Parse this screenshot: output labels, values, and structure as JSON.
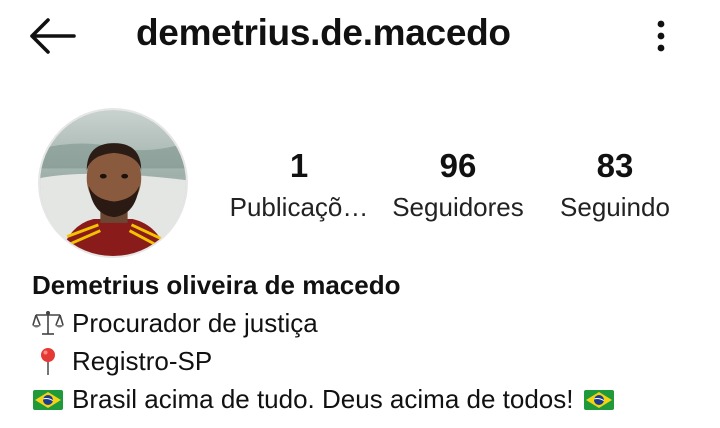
{
  "header": {
    "username": "demetrius.de.macedo"
  },
  "stats": {
    "posts": {
      "value": "1",
      "label": "Publicaçõ…"
    },
    "followers": {
      "value": "96",
      "label": "Seguidores"
    },
    "following": {
      "value": "83",
      "label": "Seguindo"
    }
  },
  "bio": {
    "name": "Demetrius oliveira de macedo",
    "lines": [
      {
        "icon": "scales-icon",
        "text": "Procurador de justiça"
      },
      {
        "icon": "pin-icon",
        "text": "Registro-SP"
      },
      {
        "icon": "brazil-flag-icon",
        "text": "Brasil acima de tudo. Deus acima de todos!"
      }
    ]
  },
  "icons": {
    "back": "arrow-left-icon",
    "menu": "vertical-dots-icon"
  },
  "colors": {
    "text": "#111111",
    "background": "#ffffff",
    "pin": "#e53935",
    "flag_green": "#1e9a3a",
    "flag_yellow": "#f5d216",
    "flag_blue": "#1d3b8b"
  }
}
